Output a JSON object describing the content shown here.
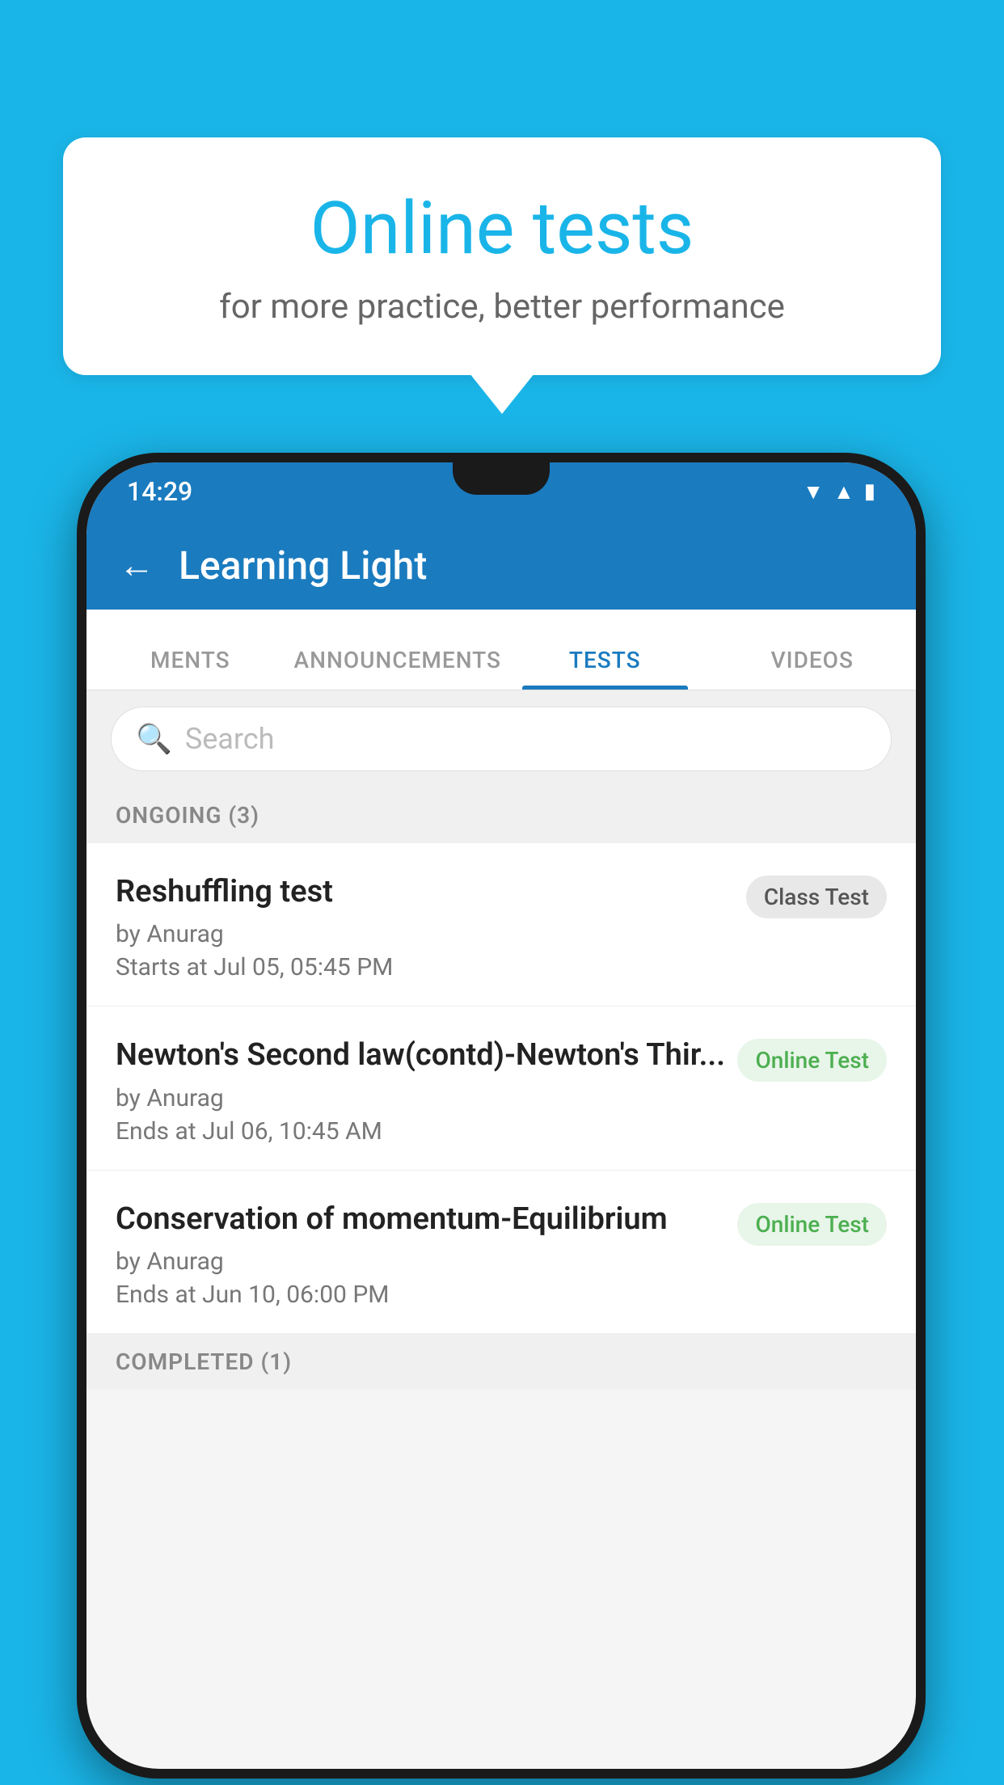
{
  "background_color": "#1ab5e8",
  "bubble": {
    "title": "Online tests",
    "subtitle": "for more practice, better performance"
  },
  "phone": {
    "status_bar": {
      "time": "14:29",
      "icons": [
        "wifi",
        "signal",
        "battery"
      ]
    },
    "app_bar": {
      "title": "Learning Light",
      "back_label": "←"
    },
    "tabs": [
      {
        "label": "MENTS",
        "active": false
      },
      {
        "label": "ANNOUNCEMENTS",
        "active": false
      },
      {
        "label": "TESTS",
        "active": true
      },
      {
        "label": "VIDEOS",
        "active": false
      }
    ],
    "search": {
      "placeholder": "Search"
    },
    "sections": [
      {
        "header": "ONGOING (3)",
        "items": [
          {
            "name": "Reshuffling test",
            "author": "by Anurag",
            "date": "Starts at  Jul 05, 05:45 PM",
            "badge": "Class Test",
            "badge_type": "class"
          },
          {
            "name": "Newton's Second law(contd)-Newton's Thir...",
            "author": "by Anurag",
            "date": "Ends at  Jul 06, 10:45 AM",
            "badge": "Online Test",
            "badge_type": "online"
          },
          {
            "name": "Conservation of momentum-Equilibrium",
            "author": "by Anurag",
            "date": "Ends at  Jun 10, 06:00 PM",
            "badge": "Online Test",
            "badge_type": "online"
          }
        ]
      }
    ],
    "completed_header": "COMPLETED (1)"
  }
}
